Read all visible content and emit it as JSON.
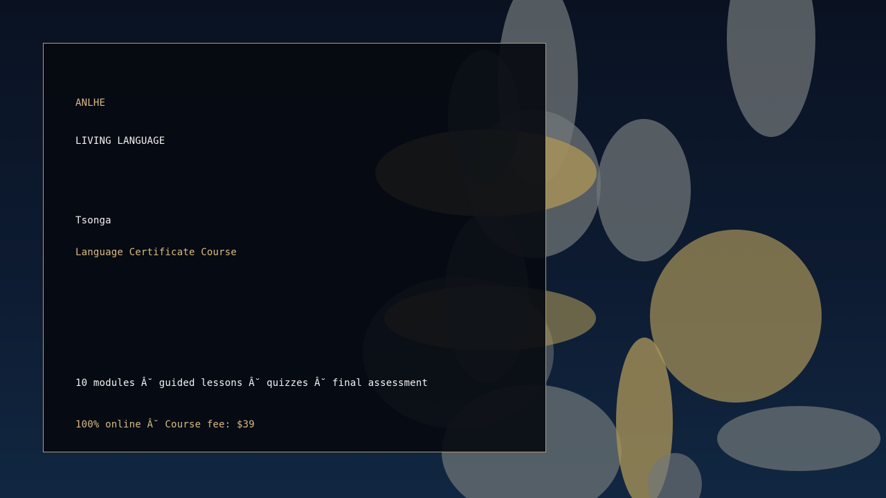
{
  "card": {
    "brand": "ANLHE",
    "series": "LIVING LANGUAGE",
    "language": "Tsonga",
    "course_type": "Language Certificate Course",
    "features": "10 modules Â˘ guided lessons Â˘ quizzes Â˘ final assessment",
    "pricing": "100% online Â˘ Course fee: $39"
  },
  "colors": {
    "accent_gold": "#d9bb82",
    "text_white": "#f2f2f2",
    "card_border": "#b59f6c",
    "background": "#0d1b31"
  }
}
